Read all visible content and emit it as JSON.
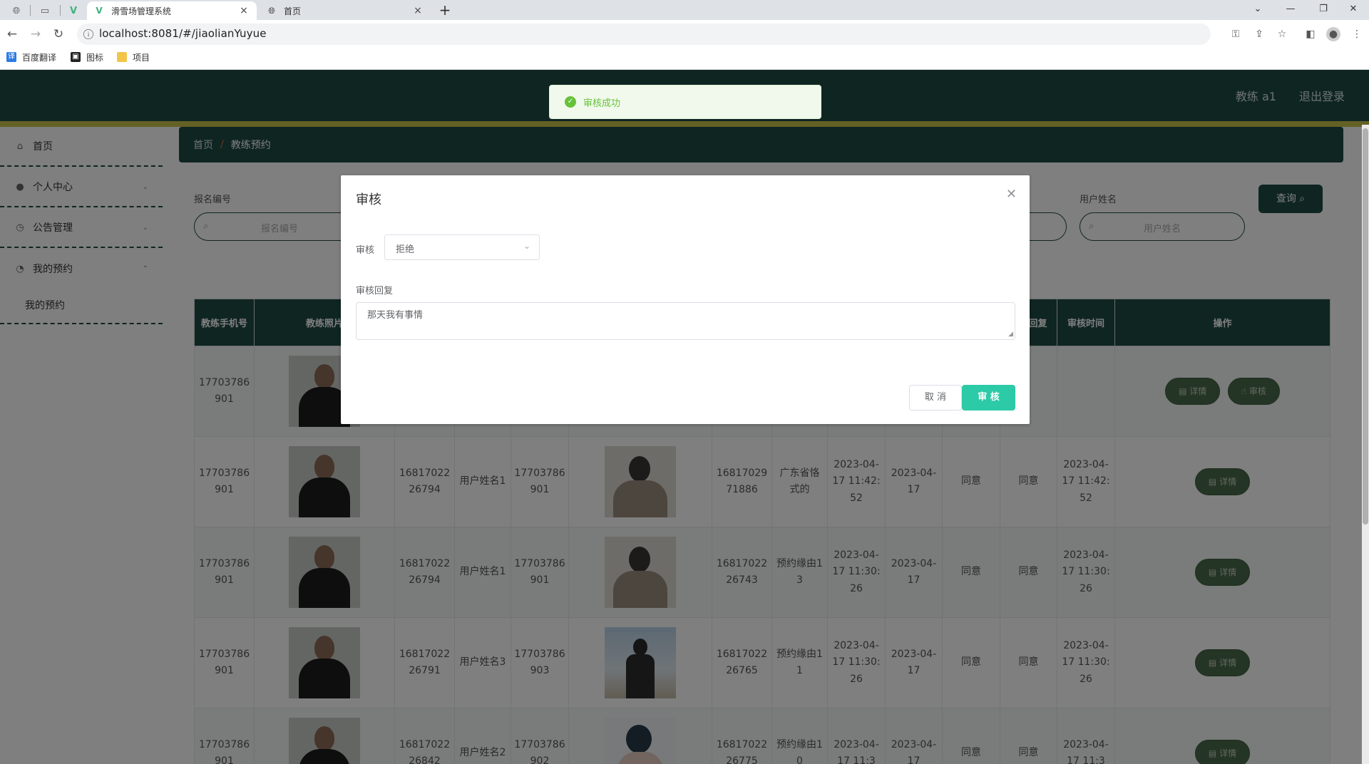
{
  "browser": {
    "tabs": [
      {
        "title": "滑雪场管理系统",
        "active": true
      },
      {
        "title": "首页",
        "active": false
      }
    ],
    "url": "localhost:8081/#/jiaolianYuyue",
    "bookmarks": [
      "百度翻译",
      "图标",
      "项目"
    ]
  },
  "header": {
    "user": "教练 a1",
    "logout": "退出登录"
  },
  "sidebar": {
    "items": [
      {
        "label": "首页",
        "icon": "home-icon"
      },
      {
        "label": "个人中心",
        "icon": "user-icon"
      },
      {
        "label": "公告管理",
        "icon": "clock-icon"
      },
      {
        "label": "我的预约",
        "icon": "compass-icon"
      }
    ],
    "subitem": "我的预约"
  },
  "breadcrumb": {
    "home": "首页",
    "separator": "/",
    "current": "教练预约"
  },
  "search": {
    "field1_label": "报名编号",
    "field1_placeholder": "报名编号",
    "field2_label": "用户姓名",
    "field2_placeholder": "用户姓名",
    "query_button": "查询"
  },
  "table": {
    "headers": [
      "教练手机号",
      "教练照片",
      "",
      "",
      "",
      "",
      "",
      "",
      "",
      "",
      "",
      "审核回复",
      "审核时间",
      "操作"
    ],
    "rows": [
      {
        "phone": "17703786901",
        "cells": [
          "",
          "",
          "",
          "",
          "",
          "",
          "",
          "",
          "",
          "",
          ""
        ],
        "buttons": [
          "详情",
          "审核"
        ]
      },
      {
        "phone": "17703786901",
        "cells": [
          "1681702226794",
          "用户姓名1",
          "17703786901",
          "",
          "1681702971886",
          "广东省恪式的",
          "2023-04-17 11:42:52",
          "2023-04-17",
          "同意",
          "同意",
          "2023-04-17 11:42:52"
        ],
        "buttons": [
          "详情"
        ]
      },
      {
        "phone": "17703786901",
        "cells": [
          "1681702226794",
          "用户姓名1",
          "17703786901",
          "",
          "1681702226743",
          "预约缘由13",
          "2023-04-17 11:30:26",
          "2023-04-17",
          "同意",
          "同意",
          "2023-04-17 11:30:26"
        ],
        "buttons": [
          "详情"
        ]
      },
      {
        "phone": "17703786901",
        "cells": [
          "1681702226791",
          "用户姓名3",
          "17703786903",
          "",
          "1681702226765",
          "预约缘由11",
          "2023-04-17 11:30:26",
          "2023-04-17",
          "同意",
          "同意",
          "2023-04-17 11:30:26"
        ],
        "buttons": [
          "详情"
        ]
      },
      {
        "phone": "17703786901",
        "cells": [
          "1681702226842",
          "用户姓名2",
          "17703786902",
          "",
          "1681702226775",
          "预约缘由10",
          "2023-04-17 11:3",
          "2023-04-17",
          "同意",
          "同意",
          "2023-04-17 11:3"
        ],
        "buttons": [
          "详情"
        ]
      }
    ]
  },
  "dialog": {
    "title": "审核",
    "field1_label": "审核",
    "field1_value": "拒绝",
    "field2_label": "审核回复",
    "field2_value": "那天我有事情",
    "cancel": "取 消",
    "submit": "审 核"
  },
  "toast": {
    "text": "审核成功"
  },
  "colors": {
    "primary": "#1e4b45",
    "accent_line": "#c9c24a",
    "success": "#67c23a",
    "submit": "#2ccaa6"
  }
}
